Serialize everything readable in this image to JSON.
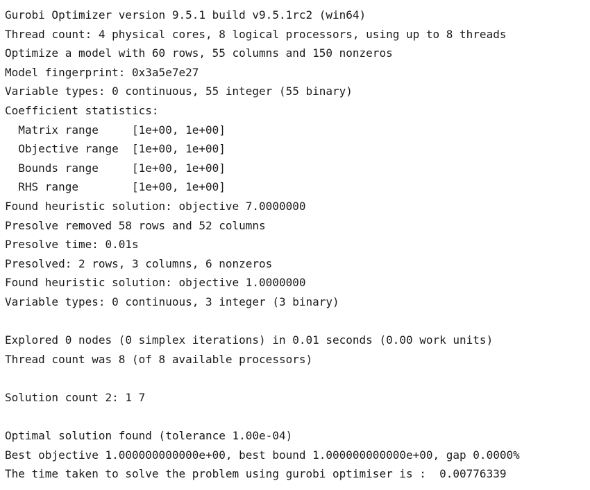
{
  "console": {
    "lines": [
      "Gurobi Optimizer version 9.5.1 build v9.5.1rc2 (win64)",
      "Thread count: 4 physical cores, 8 logical processors, using up to 8 threads",
      "Optimize a model with 60 rows, 55 columns and 150 nonzeros",
      "Model fingerprint: 0x3a5e7e27",
      "Variable types: 0 continuous, 55 integer (55 binary)",
      "Coefficient statistics:",
      "  Matrix range     [1e+00, 1e+00]",
      "  Objective range  [1e+00, 1e+00]",
      "  Bounds range     [1e+00, 1e+00]",
      "  RHS range        [1e+00, 1e+00]",
      "Found heuristic solution: objective 7.0000000",
      "Presolve removed 58 rows and 52 columns",
      "Presolve time: 0.01s",
      "Presolved: 2 rows, 3 columns, 6 nonzeros",
      "Found heuristic solution: objective 1.0000000",
      "Variable types: 0 continuous, 3 integer (3 binary)",
      "",
      "Explored 0 nodes (0 simplex iterations) in 0.01 seconds (0.00 work units)",
      "Thread count was 8 (of 8 available processors)",
      "",
      "Solution count 2: 1 7 ",
      "",
      "Optimal solution found (tolerance 1.00e-04)",
      "Best objective 1.000000000000e+00, best bound 1.000000000000e+00, gap 0.0000%",
      "The time taken to solve the problem using gurobi optimiser is :  0.00776339"
    ]
  }
}
